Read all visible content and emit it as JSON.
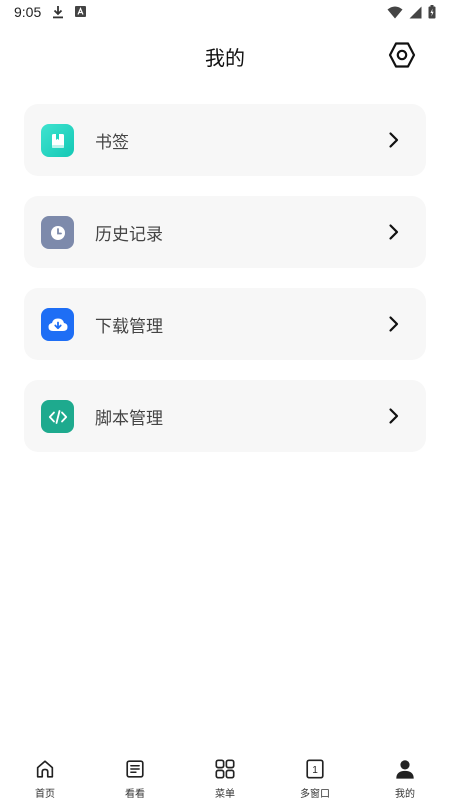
{
  "status_bar": {
    "time": "9:05",
    "icons": [
      "download-icon",
      "a-icon",
      "wifi-icon",
      "signal-icon",
      "battery-icon"
    ]
  },
  "header": {
    "title": "我的",
    "settings_icon": "hexagon-settings-icon"
  },
  "menu": {
    "items": [
      {
        "label": "书签",
        "icon": "bookmark-icon",
        "color": "#21d6c0"
      },
      {
        "label": "历史记录",
        "icon": "clock-icon",
        "color": "#7d8aab"
      },
      {
        "label": "下载管理",
        "icon": "cloud-download-icon",
        "color": "#1e6ef5"
      },
      {
        "label": "脚本管理",
        "icon": "code-icon",
        "color": "#1eaa8e"
      }
    ]
  },
  "bottom_nav": {
    "items": [
      {
        "label": "首页",
        "icon": "home-icon"
      },
      {
        "label": "看看",
        "icon": "document-icon"
      },
      {
        "label": "菜单",
        "icon": "grid-icon"
      },
      {
        "label": "多窗口",
        "icon": "windows-count-icon",
        "count": "1"
      },
      {
        "label": "我的",
        "icon": "user-icon",
        "active": true
      }
    ]
  }
}
